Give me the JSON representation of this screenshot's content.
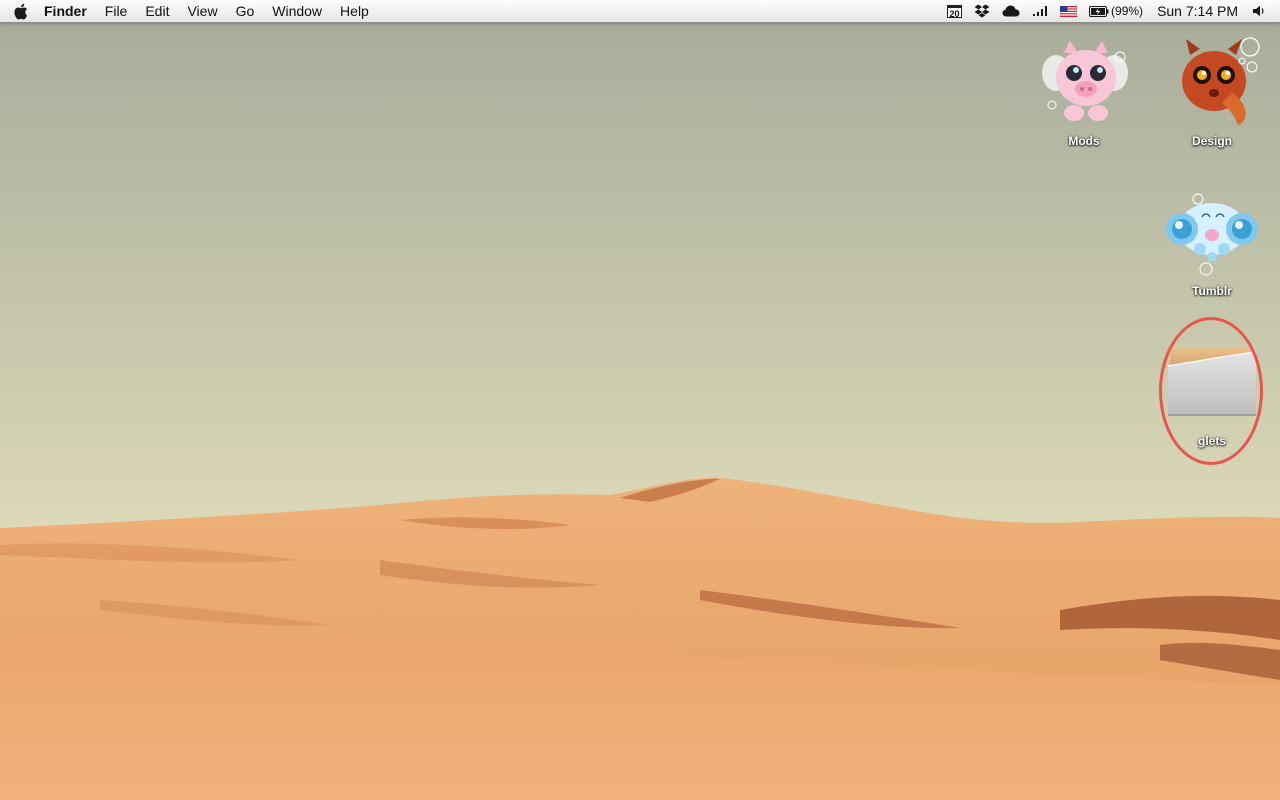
{
  "menubar": {
    "apple_icon": "apple-logo-icon",
    "app_name": "Finder",
    "menus": [
      "File",
      "Edit",
      "View",
      "Go",
      "Window",
      "Help"
    ],
    "status": {
      "calendar_date": "20",
      "dropbox_icon": "dropbox-icon",
      "cloud_icon": "cloud-icon",
      "signal_icon": "signal-bars-icon",
      "flag_icon": "us-flag-input-icon",
      "battery_icon": "battery-charging-icon",
      "battery_percent": "(99%)",
      "clock": "Sun 7:14 PM",
      "volume_icon": "speaker-volume-icon"
    }
  },
  "desktop": {
    "icons": [
      {
        "label": "Mods",
        "icon": "pink-creature-icon"
      },
      {
        "label": "Design",
        "icon": "red-fish-creature-icon"
      },
      {
        "label": "Tumblr",
        "icon": "blue-bubble-creature-icon"
      },
      {
        "label": "glets",
        "icon": "folder-icon",
        "highlighted": true
      }
    ],
    "highlight_color": "#e8554e"
  },
  "colors": {
    "sky_top": "#a9ad9b",
    "sky_bottom": "#dcd9b6",
    "sand": "#e6a266",
    "sand_shadow": "#b8683a"
  }
}
